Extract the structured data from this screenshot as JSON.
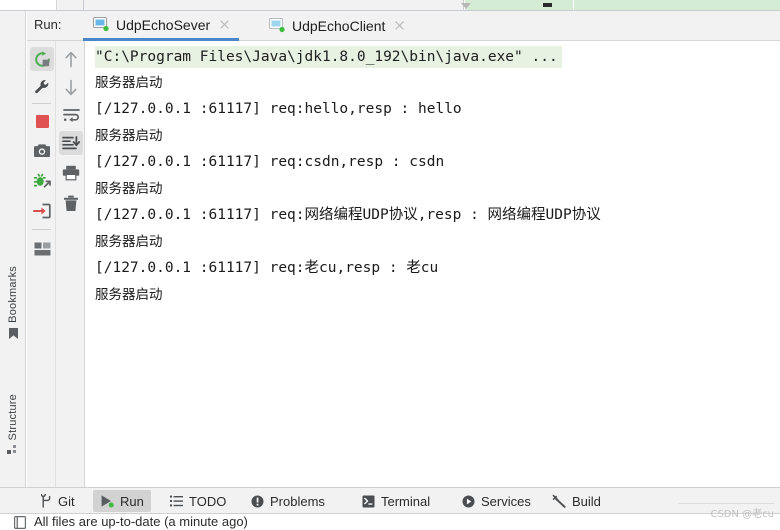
{
  "window": {
    "run_label": "Run:"
  },
  "tabs": [
    {
      "label": "UdpEchoSever",
      "icon": "console-window-icon",
      "active": true,
      "close": "close-icon"
    },
    {
      "label": "UdpEchoClient",
      "icon": "console-window-icon",
      "active": false,
      "close": "close-icon"
    }
  ],
  "toolbar_primary": [
    {
      "name": "rerun-icon",
      "title": "Rerun",
      "selected": true
    },
    {
      "name": "wrench-icon",
      "title": "Modify Run Configuration",
      "selected": false
    },
    {
      "name": "stop-icon",
      "title": "Stop",
      "selected": false
    },
    {
      "name": "camera-icon",
      "title": "Screenshot",
      "selected": false
    },
    {
      "name": "debug-restore-icon",
      "title": "Restore Layout",
      "selected": false
    },
    {
      "name": "export-icon",
      "title": "Export",
      "selected": false
    },
    {
      "name": "layout-icon",
      "title": "Layout Settings",
      "selected": false
    }
  ],
  "toolbar_secondary": [
    {
      "name": "arrow-up-icon",
      "title": "Up",
      "selected": false
    },
    {
      "name": "arrow-down-icon",
      "title": "Down",
      "selected": false
    },
    {
      "name": "soft-wrap-icon",
      "title": "Soft-Wrap",
      "selected": false
    },
    {
      "name": "scroll-to-end-icon",
      "title": "Scroll to End",
      "selected": true
    },
    {
      "name": "print-icon",
      "title": "Print",
      "selected": false
    },
    {
      "name": "trash-icon",
      "title": "Clear All",
      "selected": false
    }
  ],
  "console": {
    "lines": [
      {
        "text": "\"C:\\Program Files\\Java\\jdk1.8.0_192\\bin\\java.exe\" ...",
        "style": "cmd"
      },
      {
        "text": "服务器启动",
        "style": "cjk"
      },
      {
        "text": "[/127.0.0.1 :61117] req:hello,resp : hello",
        "style": "mono"
      },
      {
        "text": "服务器启动",
        "style": "cjk"
      },
      {
        "text": "[/127.0.0.1 :61117] req:csdn,resp : csdn",
        "style": "mono"
      },
      {
        "text": "服务器启动",
        "style": "cjk"
      },
      {
        "text": "[/127.0.0.1 :61117] req:网络编程UDP协议,resp : 网络编程UDP协议",
        "style": "mono"
      },
      {
        "text": "服务器启动",
        "style": "cjk"
      },
      {
        "text": "[/127.0.0.1 :61117] req:老cu,resp : 老cu",
        "style": "mono"
      },
      {
        "text": "服务器启动",
        "style": "cjk"
      }
    ]
  },
  "vertical_sidebar": [
    {
      "label": "Bookmarks",
      "icon": "bookmark-icon"
    },
    {
      "label": "Structure",
      "icon": "structure-grid-icon"
    }
  ],
  "status_bar": [
    {
      "label": "Git",
      "icon": "git-branch-icon",
      "active": false
    },
    {
      "label": "Run",
      "icon": "run-play-icon",
      "active": true
    },
    {
      "label": "TODO",
      "icon": "todo-list-icon",
      "active": false
    },
    {
      "label": "Problems",
      "icon": "problems-icon",
      "active": false
    },
    {
      "label": "Terminal",
      "icon": "terminal-icon",
      "active": false
    },
    {
      "label": "Services",
      "icon": "services-icon",
      "active": false
    },
    {
      "label": "Build",
      "icon": "build-hammer-icon",
      "active": false
    }
  ],
  "bottom": {
    "sync_text": "All files are up-to-date (a minute ago)",
    "sync_icon": "file-sync-icon"
  },
  "watermark": {
    "text": "CSDN @老cu"
  },
  "colors": {
    "accent_blue": "#4a86c8",
    "stop_red": "#e05252",
    "run_green": "#4caf50",
    "cmd_highlight": "#e7f2e2",
    "panel_gray": "#f2f2f2"
  }
}
